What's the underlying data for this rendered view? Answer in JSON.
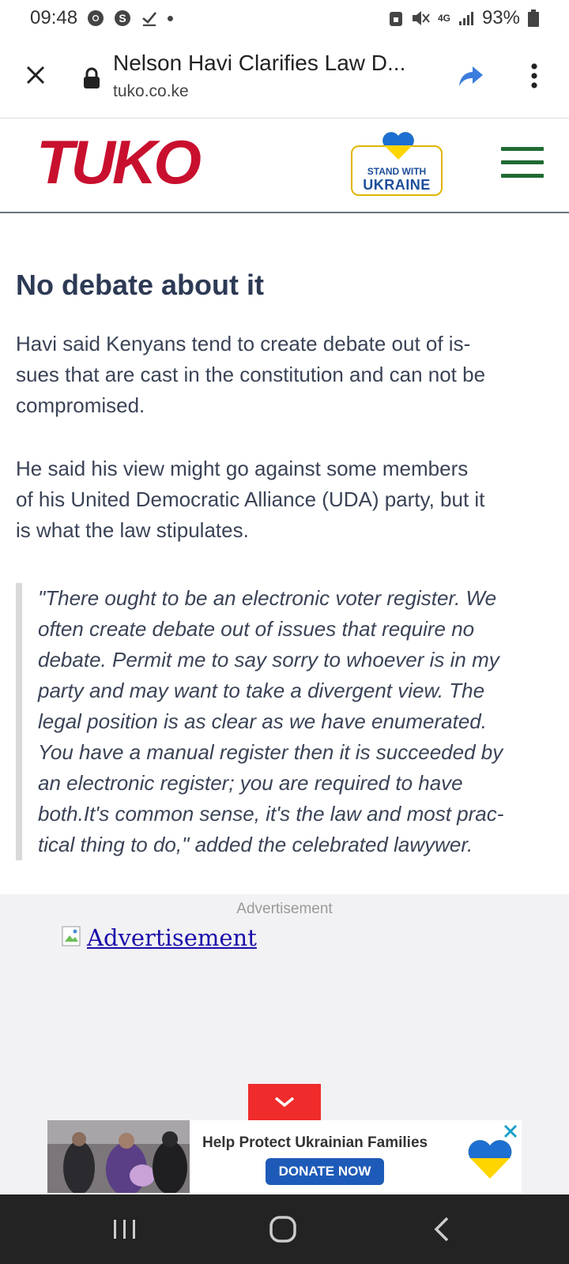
{
  "status_bar": {
    "time": "09:48",
    "network": "4G",
    "battery": "93%",
    "icons": [
      "chrome-icon",
      "s-icon",
      "check-icon",
      "dot-icon",
      "lock-badge-icon",
      "mute-icon",
      "signal-icon",
      "battery-icon"
    ]
  },
  "browser": {
    "page_title": "Nelson Havi Clarifies Law D...",
    "domain": "tuko.co.ke"
  },
  "site": {
    "logo_text": "TUKO",
    "badge_line1": "STAND WITH",
    "badge_line2": "UKRAINE",
    "colors": {
      "logo": "#c8102e",
      "menu": "#1f6b32",
      "ukraine_blue": "#1d4e9a",
      "ukraine_yellow": "#ffd500"
    }
  },
  "article": {
    "heading": "No debate about it",
    "p1_line1": "Havi said Kenyans tend to create debate out of is-",
    "p1_line2": "sues that are cast in the constitution and can not be",
    "p1_line3": "compromised.",
    "p2_line1": "He said his view might go against some members",
    "p2_line2": "of his United Democratic Alliance (UDA) party, but it",
    "p2_line3": "is what the law stipulates.",
    "quote_lines": [
      "\"There ought to be an electronic voter register. We",
      "often create debate out of issues that require no",
      "debate. Permit me to say sorry to whoever is in my",
      "party and may want to take a divergent view. The",
      "legal position is as clear as we have enumerated.",
      "You have a manual register then it is succeeded by",
      "an electronic register; you are required to have",
      "both.It's common sense, it's the law and most prac-",
      "tical thing to do,\" added the celebrated lawywer."
    ]
  },
  "ad": {
    "label": "Advertisement",
    "link_text": "Advertisement"
  },
  "banner": {
    "text": "Help Protect Ukrainian Families",
    "button": "DONATE NOW"
  }
}
